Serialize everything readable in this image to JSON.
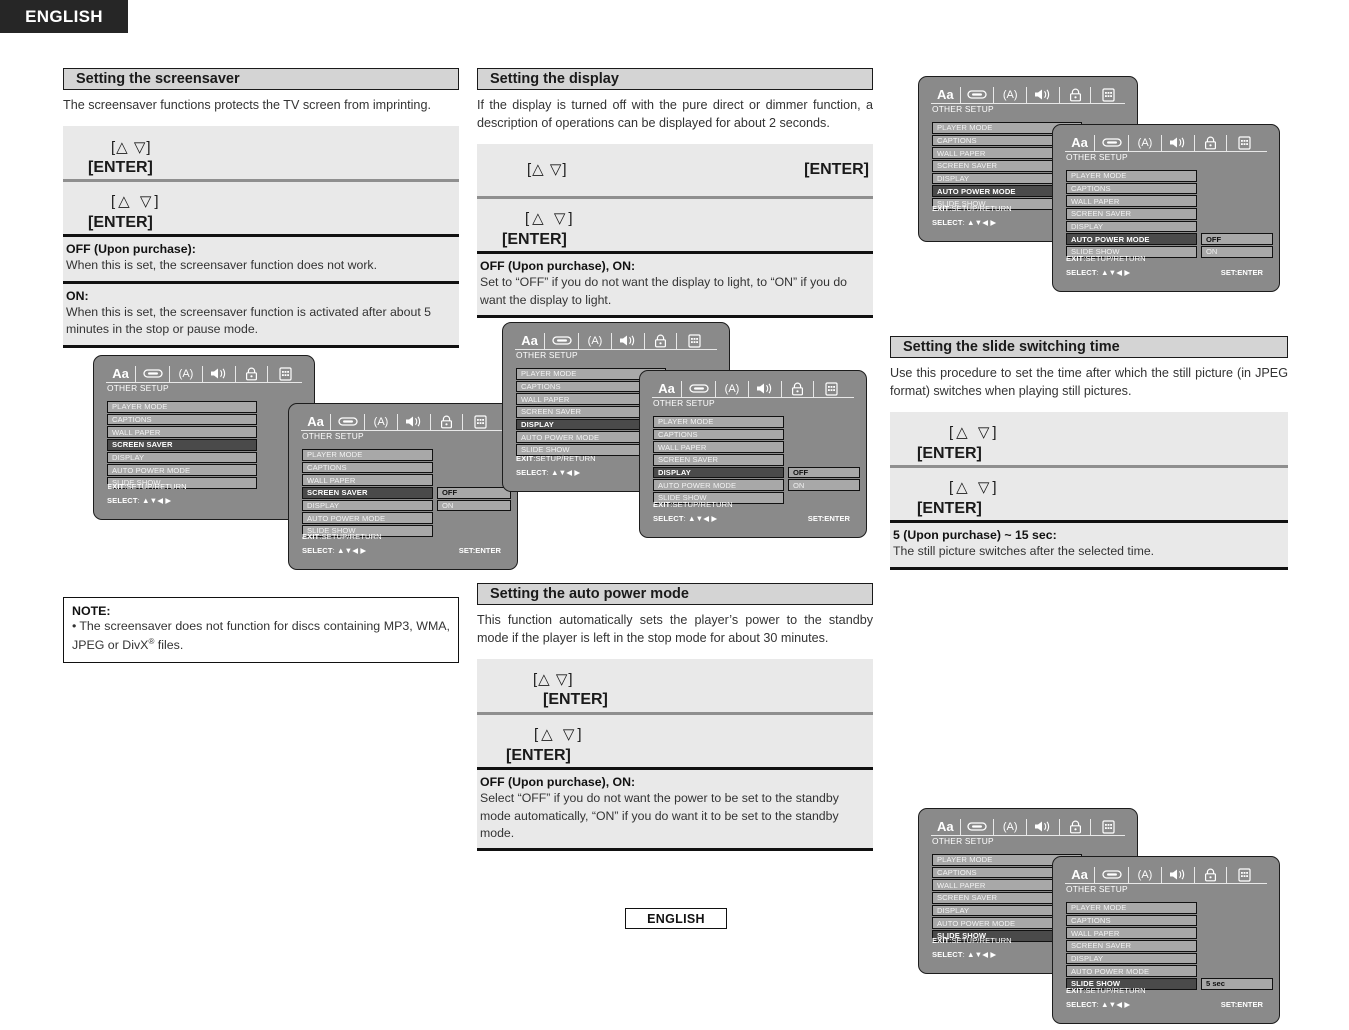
{
  "page": {
    "language_tab": "ENGLISH",
    "footer_language": "ENGLISH"
  },
  "keys": {
    "updown": "[△ ▽]",
    "enter": "[ENTER]"
  },
  "osd_common": {
    "title": "OTHER SETUP",
    "icons": [
      "Aa",
      "disc-icon",
      "(A)",
      "speaker-icon",
      "lock-icon",
      "grid-icon"
    ],
    "menu_items": [
      "PLAYER MODE",
      "CAPTIONS",
      "WALL PAPER",
      "SCREEN SAVER",
      "DISPLAY",
      "AUTO POWER MODE",
      "SLIDE SHOW"
    ],
    "exit_label": "EXIT:SETUP/RETURN",
    "select_label": "SELECT:",
    "select_arrows": "▲▼◀ ▶",
    "set_label": "SET:ENTER"
  },
  "sections": {
    "screensaver": {
      "heading": "Setting the screensaver",
      "intro": "The screensaver functions protects the TV screen from imprinting.",
      "options": [
        {
          "title": "OFF (Upon purchase):",
          "body": "When this is set, the screensaver function does not work."
        },
        {
          "title": "ON:",
          "body": "When this is set, the screensaver function is activated after about 5 minutes in the stop or pause mode."
        }
      ],
      "note": {
        "heading": "NOTE:",
        "body_pre": "The screensaver does not function for discs containing MP3, WMA, JPEG or DivX",
        "body_sup": "®",
        "body_post": " files."
      },
      "osd_back_selected": "SCREEN SAVER",
      "osd_front_selected": "SCREEN SAVER",
      "osd_values": [
        "OFF",
        "ON"
      ]
    },
    "display": {
      "heading": "Setting the display",
      "intro": "If the display is turned off with the pure direct or dimmer function, a description of operations can be displayed for about 2 seconds.",
      "options": [
        {
          "title": "OFF (Upon purchase), ON:",
          "body": "Set to “OFF” if you do not want the display to light, to “ON” if you do want the display to light."
        }
      ],
      "osd_back_selected": "DISPLAY",
      "osd_front_selected": "DISPLAY",
      "osd_values": [
        "OFF",
        "ON"
      ]
    },
    "auto_power": {
      "heading": "Setting the auto power mode",
      "intro": "This function automatically sets the player’s power to the standby mode if the player is left in the stop mode for about 30 minutes.",
      "options": [
        {
          "title": "OFF (Upon purchase), ON:",
          "body": "Select “OFF” if you do not want the power to be set to the standby mode automatically, “ON” if you do want it to be set to the standby mode."
        }
      ],
      "osd_back_selected": "AUTO POWER MODE",
      "osd_front_selected": "AUTO POWER MODE",
      "osd_values": [
        "OFF",
        "ON"
      ]
    },
    "slide_time": {
      "heading": "Setting the slide switching time",
      "intro": "Use this procedure to set the time after which the still picture (in JPEG format) switches when playing still pictures.",
      "options": [
        {
          "title": "5 (Upon purchase) ~ 15 sec:",
          "body": "The still picture switches after the selected time."
        }
      ],
      "osd_back_selected": "SLIDE SHOW",
      "osd_front_selected": "SLIDE SHOW",
      "osd_values": [
        "5 sec"
      ]
    }
  }
}
